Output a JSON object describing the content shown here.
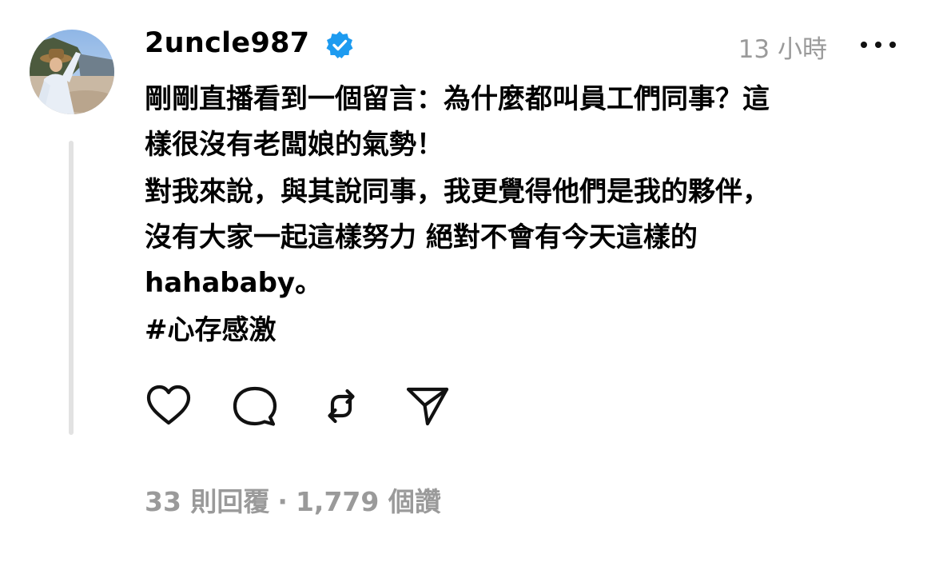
{
  "post": {
    "username": "2uncle987",
    "verified": true,
    "timestamp": "13 小時",
    "body_lines": [
      [
        "剛剛直播看到一個留言：為什麼都叫員工們同事？這",
        "樣很沒有老闆娘的氣勢！"
      ],
      [
        "對我來說，與其說同事，我更覺得他們是我的夥伴，",
        "沒有大家一起這樣努力 絕對不會有今天這樣的",
        "hahababy。"
      ]
    ],
    "hashtag": "#心存感激",
    "stats": {
      "replies": "33 則回覆",
      "separator": "·",
      "likes": "1,779 個讚"
    }
  },
  "icons": {
    "verified": "verified-badge-icon",
    "more": "more-options-icon",
    "like": "heart-icon",
    "reply": "comment-bubble-icon",
    "repost": "repost-icon",
    "share": "send-icon"
  },
  "colors": {
    "verified_blue": "#1d9bf0",
    "muted_text": "#9a9a9a",
    "thread_line": "#e2e2e2"
  }
}
